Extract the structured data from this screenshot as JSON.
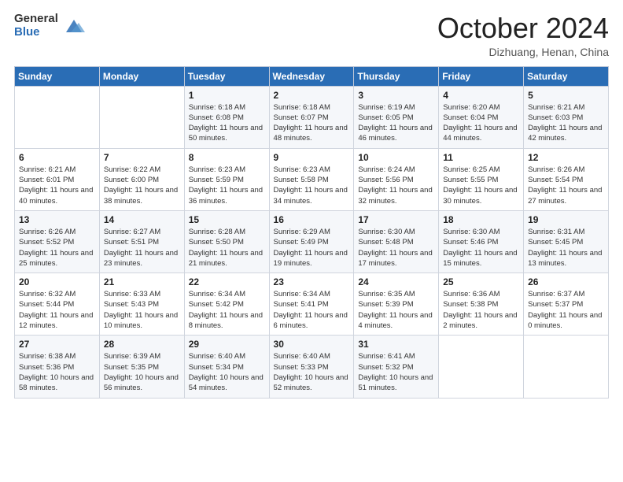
{
  "header": {
    "logo_general": "General",
    "logo_blue": "Blue",
    "title": "October 2024",
    "location": "Dizhuang, Henan, China"
  },
  "days_of_week": [
    "Sunday",
    "Monday",
    "Tuesday",
    "Wednesday",
    "Thursday",
    "Friday",
    "Saturday"
  ],
  "weeks": [
    [
      {
        "day": "",
        "content": ""
      },
      {
        "day": "",
        "content": ""
      },
      {
        "day": "1",
        "content": "Sunrise: 6:18 AM\nSunset: 6:08 PM\nDaylight: 11 hours and 50 minutes."
      },
      {
        "day": "2",
        "content": "Sunrise: 6:18 AM\nSunset: 6:07 PM\nDaylight: 11 hours and 48 minutes."
      },
      {
        "day": "3",
        "content": "Sunrise: 6:19 AM\nSunset: 6:05 PM\nDaylight: 11 hours and 46 minutes."
      },
      {
        "day": "4",
        "content": "Sunrise: 6:20 AM\nSunset: 6:04 PM\nDaylight: 11 hours and 44 minutes."
      },
      {
        "day": "5",
        "content": "Sunrise: 6:21 AM\nSunset: 6:03 PM\nDaylight: 11 hours and 42 minutes."
      }
    ],
    [
      {
        "day": "6",
        "content": "Sunrise: 6:21 AM\nSunset: 6:01 PM\nDaylight: 11 hours and 40 minutes."
      },
      {
        "day": "7",
        "content": "Sunrise: 6:22 AM\nSunset: 6:00 PM\nDaylight: 11 hours and 38 minutes."
      },
      {
        "day": "8",
        "content": "Sunrise: 6:23 AM\nSunset: 5:59 PM\nDaylight: 11 hours and 36 minutes."
      },
      {
        "day": "9",
        "content": "Sunrise: 6:23 AM\nSunset: 5:58 PM\nDaylight: 11 hours and 34 minutes."
      },
      {
        "day": "10",
        "content": "Sunrise: 6:24 AM\nSunset: 5:56 PM\nDaylight: 11 hours and 32 minutes."
      },
      {
        "day": "11",
        "content": "Sunrise: 6:25 AM\nSunset: 5:55 PM\nDaylight: 11 hours and 30 minutes."
      },
      {
        "day": "12",
        "content": "Sunrise: 6:26 AM\nSunset: 5:54 PM\nDaylight: 11 hours and 27 minutes."
      }
    ],
    [
      {
        "day": "13",
        "content": "Sunrise: 6:26 AM\nSunset: 5:52 PM\nDaylight: 11 hours and 25 minutes."
      },
      {
        "day": "14",
        "content": "Sunrise: 6:27 AM\nSunset: 5:51 PM\nDaylight: 11 hours and 23 minutes."
      },
      {
        "day": "15",
        "content": "Sunrise: 6:28 AM\nSunset: 5:50 PM\nDaylight: 11 hours and 21 minutes."
      },
      {
        "day": "16",
        "content": "Sunrise: 6:29 AM\nSunset: 5:49 PM\nDaylight: 11 hours and 19 minutes."
      },
      {
        "day": "17",
        "content": "Sunrise: 6:30 AM\nSunset: 5:48 PM\nDaylight: 11 hours and 17 minutes."
      },
      {
        "day": "18",
        "content": "Sunrise: 6:30 AM\nSunset: 5:46 PM\nDaylight: 11 hours and 15 minutes."
      },
      {
        "day": "19",
        "content": "Sunrise: 6:31 AM\nSunset: 5:45 PM\nDaylight: 11 hours and 13 minutes."
      }
    ],
    [
      {
        "day": "20",
        "content": "Sunrise: 6:32 AM\nSunset: 5:44 PM\nDaylight: 11 hours and 12 minutes."
      },
      {
        "day": "21",
        "content": "Sunrise: 6:33 AM\nSunset: 5:43 PM\nDaylight: 11 hours and 10 minutes."
      },
      {
        "day": "22",
        "content": "Sunrise: 6:34 AM\nSunset: 5:42 PM\nDaylight: 11 hours and 8 minutes."
      },
      {
        "day": "23",
        "content": "Sunrise: 6:34 AM\nSunset: 5:41 PM\nDaylight: 11 hours and 6 minutes."
      },
      {
        "day": "24",
        "content": "Sunrise: 6:35 AM\nSunset: 5:39 PM\nDaylight: 11 hours and 4 minutes."
      },
      {
        "day": "25",
        "content": "Sunrise: 6:36 AM\nSunset: 5:38 PM\nDaylight: 11 hours and 2 minutes."
      },
      {
        "day": "26",
        "content": "Sunrise: 6:37 AM\nSunset: 5:37 PM\nDaylight: 11 hours and 0 minutes."
      }
    ],
    [
      {
        "day": "27",
        "content": "Sunrise: 6:38 AM\nSunset: 5:36 PM\nDaylight: 10 hours and 58 minutes."
      },
      {
        "day": "28",
        "content": "Sunrise: 6:39 AM\nSunset: 5:35 PM\nDaylight: 10 hours and 56 minutes."
      },
      {
        "day": "29",
        "content": "Sunrise: 6:40 AM\nSunset: 5:34 PM\nDaylight: 10 hours and 54 minutes."
      },
      {
        "day": "30",
        "content": "Sunrise: 6:40 AM\nSunset: 5:33 PM\nDaylight: 10 hours and 52 minutes."
      },
      {
        "day": "31",
        "content": "Sunrise: 6:41 AM\nSunset: 5:32 PM\nDaylight: 10 hours and 51 minutes."
      },
      {
        "day": "",
        "content": ""
      },
      {
        "day": "",
        "content": ""
      }
    ]
  ]
}
